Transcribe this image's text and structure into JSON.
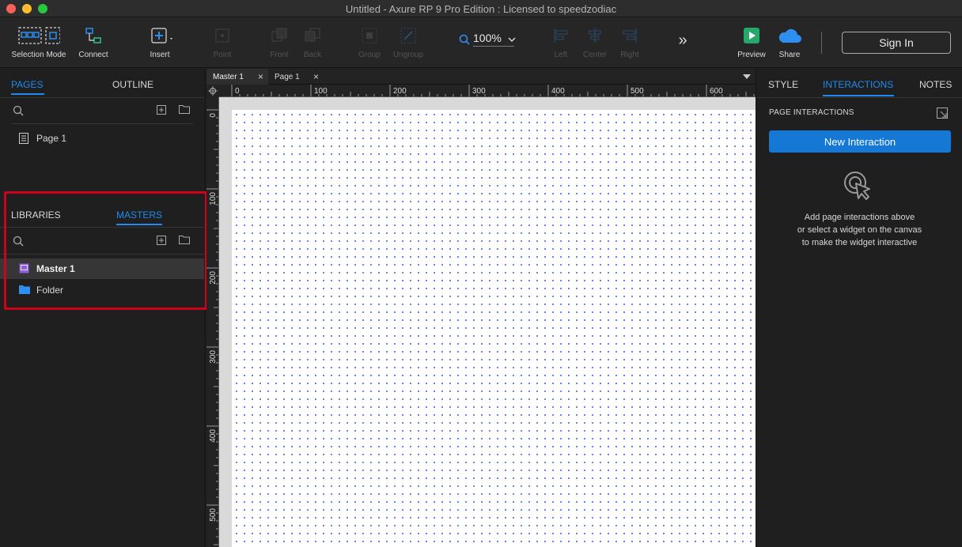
{
  "window": {
    "title": "Untitled - Axure RP 9 Pro Edition : Licensed to speedzodiac"
  },
  "toolbar": {
    "selection_mode": "Selection Mode",
    "connect": "Connect",
    "insert": "Insert",
    "point": "Point",
    "front": "Front",
    "back": "Back",
    "group": "Group",
    "ungroup": "Ungroup",
    "zoom": "100%",
    "left": "Left",
    "center": "Center",
    "right": "Right",
    "more": "»",
    "preview": "Preview",
    "share": "Share",
    "sign_in": "Sign In"
  },
  "left_panel": {
    "tabs": {
      "pages": "PAGES",
      "outline": "OUTLINE"
    },
    "pages": [
      {
        "label": "Page 1"
      }
    ],
    "lower_tabs": {
      "libraries": "LIBRARIES",
      "masters": "MASTERS"
    },
    "masters": [
      {
        "label": "Master 1",
        "selected": true
      },
      {
        "label": "Folder",
        "selected": false
      }
    ]
  },
  "doc_tabs": [
    {
      "label": "Master 1",
      "active": true
    },
    {
      "label": "Page 1",
      "active": false
    }
  ],
  "rulers": {
    "horizontal": [
      "0",
      "100",
      "200",
      "300",
      "400",
      "500",
      "600"
    ],
    "vertical": [
      "0",
      "100",
      "200",
      "300",
      "400",
      "500"
    ]
  },
  "right_panel": {
    "tabs": {
      "style": "STYLE",
      "interactions": "INTERACTIONS",
      "notes": "NOTES"
    },
    "section_title": "PAGE INTERACTIONS",
    "new_interaction": "New Interaction",
    "hint": [
      "Add page interactions above",
      "or select a widget on the canvas",
      "to make the widget interactive"
    ]
  },
  "colors": {
    "accent": "#1e8bf0",
    "highlight": "#d0021b",
    "button": "#1478d4"
  }
}
